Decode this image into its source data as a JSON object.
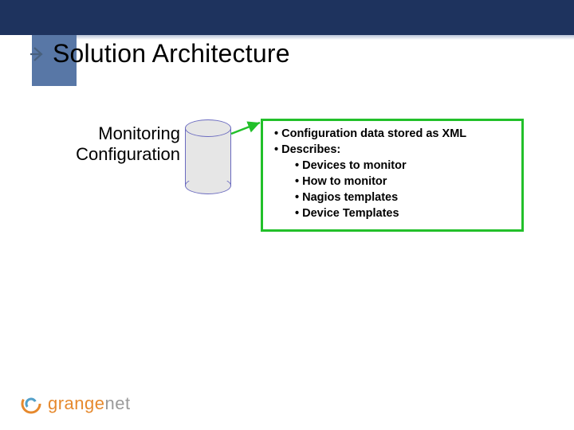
{
  "slide": {
    "title": "Solution Architecture",
    "label": {
      "line1": "Monitoring",
      "line2": "Configuration"
    },
    "callout": {
      "items": [
        {
          "text": "Configuration data stored as XML",
          "level": 1
        },
        {
          "text": "Describes:",
          "level": 1
        },
        {
          "text": "Devices to monitor",
          "level": 2
        },
        {
          "text": "How to monitor",
          "level": 2
        },
        {
          "text": "Nagios templates",
          "level": 2
        },
        {
          "text": "Device Templates",
          "level": 2
        }
      ]
    },
    "logo": {
      "text_primary": "grange",
      "text_secondary": "net"
    },
    "colors": {
      "navy": "#1e335e",
      "accent_blue": "#5877a6",
      "callout_border": "#22c02a",
      "cylinder_stroke": "#6b6bc0",
      "logo_orange": "#e6892d",
      "logo_grey": "#9a9a9a"
    }
  }
}
